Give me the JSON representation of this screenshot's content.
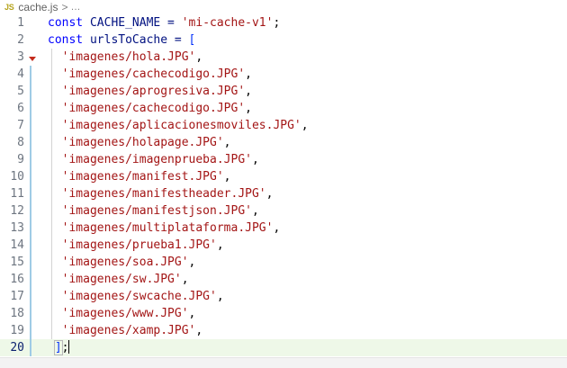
{
  "breadcrumb": {
    "file_badge": "JS",
    "file_name": "cache.js",
    "separator": ">",
    "more": "…",
    "badge_icon": "javascript-file-icon"
  },
  "editor": {
    "current_line": 20,
    "accent_colors": {
      "keyword": "#0000ff",
      "string": "#a31515",
      "line_highlight": "#eef8e8",
      "modified_gutter": "#9fcbe5"
    },
    "lines": [
      {
        "number": "1",
        "tokens": [
          {
            "t": "const",
            "c": "#0000ff"
          },
          {
            "t": " CACHE_NAME = ",
            "c": "#001080"
          },
          {
            "t": "'mi-cache-v1'",
            "c": "#a31515"
          },
          {
            "t": ";",
            "c": "#000000"
          }
        ]
      },
      {
        "number": "2",
        "tokens": [
          {
            "t": "const",
            "c": "#0000ff"
          },
          {
            "t": " urlsToCache = ",
            "c": "#001080"
          },
          {
            "t": "[",
            "c": "#0431fa"
          }
        ]
      },
      {
        "number": "3",
        "tokens": [
          {
            "t": "  'imagenes/hola.JPG'",
            "c": "#a31515"
          },
          {
            "t": ",",
            "c": "#000000"
          }
        ]
      },
      {
        "number": "4",
        "tokens": [
          {
            "t": "  'imagenes/cachecodigo.JPG'",
            "c": "#a31515"
          },
          {
            "t": ",",
            "c": "#000000"
          }
        ]
      },
      {
        "number": "5",
        "tokens": [
          {
            "t": "  'imagenes/aprogresiva.JPG'",
            "c": "#a31515"
          },
          {
            "t": ",",
            "c": "#000000"
          }
        ]
      },
      {
        "number": "6",
        "tokens": [
          {
            "t": "  'imagenes/cachecodigo.JPG'",
            "c": "#a31515"
          },
          {
            "t": ",",
            "c": "#000000"
          }
        ]
      },
      {
        "number": "7",
        "tokens": [
          {
            "t": "  'imagenes/aplicacionesmoviles.JPG'",
            "c": "#a31515"
          },
          {
            "t": ",",
            "c": "#000000"
          }
        ]
      },
      {
        "number": "8",
        "tokens": [
          {
            "t": "  'imagenes/holapage.JPG'",
            "c": "#a31515"
          },
          {
            "t": ",",
            "c": "#000000"
          }
        ]
      },
      {
        "number": "9",
        "tokens": [
          {
            "t": "  'imagenes/imagenprueba.JPG'",
            "c": "#a31515"
          },
          {
            "t": ",",
            "c": "#000000"
          }
        ]
      },
      {
        "number": "10",
        "tokens": [
          {
            "t": "  'imagenes/manifest.JPG'",
            "c": "#a31515"
          },
          {
            "t": ",",
            "c": "#000000"
          }
        ]
      },
      {
        "number": "11",
        "tokens": [
          {
            "t": "  'imagenes/manifestheader.JPG'",
            "c": "#a31515"
          },
          {
            "t": ",",
            "c": "#000000"
          }
        ]
      },
      {
        "number": "12",
        "tokens": [
          {
            "t": "  'imagenes/manifestjson.JPG'",
            "c": "#a31515"
          },
          {
            "t": ",",
            "c": "#000000"
          }
        ]
      },
      {
        "number": "13",
        "tokens": [
          {
            "t": "  'imagenes/multiplataforma.JPG'",
            "c": "#a31515"
          },
          {
            "t": ",",
            "c": "#000000"
          }
        ]
      },
      {
        "number": "14",
        "tokens": [
          {
            "t": "  'imagenes/prueba1.JPG'",
            "c": "#a31515"
          },
          {
            "t": ",",
            "c": "#000000"
          }
        ]
      },
      {
        "number": "15",
        "tokens": [
          {
            "t": "  'imagenes/soa.JPG'",
            "c": "#a31515"
          },
          {
            "t": ",",
            "c": "#000000"
          }
        ]
      },
      {
        "number": "16",
        "tokens": [
          {
            "t": "  'imagenes/sw.JPG'",
            "c": "#a31515"
          },
          {
            "t": ",",
            "c": "#000000"
          }
        ]
      },
      {
        "number": "17",
        "tokens": [
          {
            "t": "  'imagenes/swcache.JPG'",
            "c": "#a31515"
          },
          {
            "t": ",",
            "c": "#000000"
          }
        ]
      },
      {
        "number": "18",
        "tokens": [
          {
            "t": "  'imagenes/www.JPG'",
            "c": "#a31515"
          },
          {
            "t": ",",
            "c": "#000000"
          }
        ]
      },
      {
        "number": "19",
        "tokens": [
          {
            "t": "  'imagenes/xamp.JPG'",
            "c": "#a31515"
          },
          {
            "t": ",",
            "c": "#000000"
          }
        ]
      },
      {
        "number": "20",
        "tokens": [
          {
            "t": " ",
            "c": "#000000"
          },
          {
            "t": "]",
            "c": "#0431fa",
            "box": true
          },
          {
            "t": ";",
            "c": "#000000"
          },
          {
            "t": "",
            "cursor": true
          }
        ]
      }
    ]
  }
}
